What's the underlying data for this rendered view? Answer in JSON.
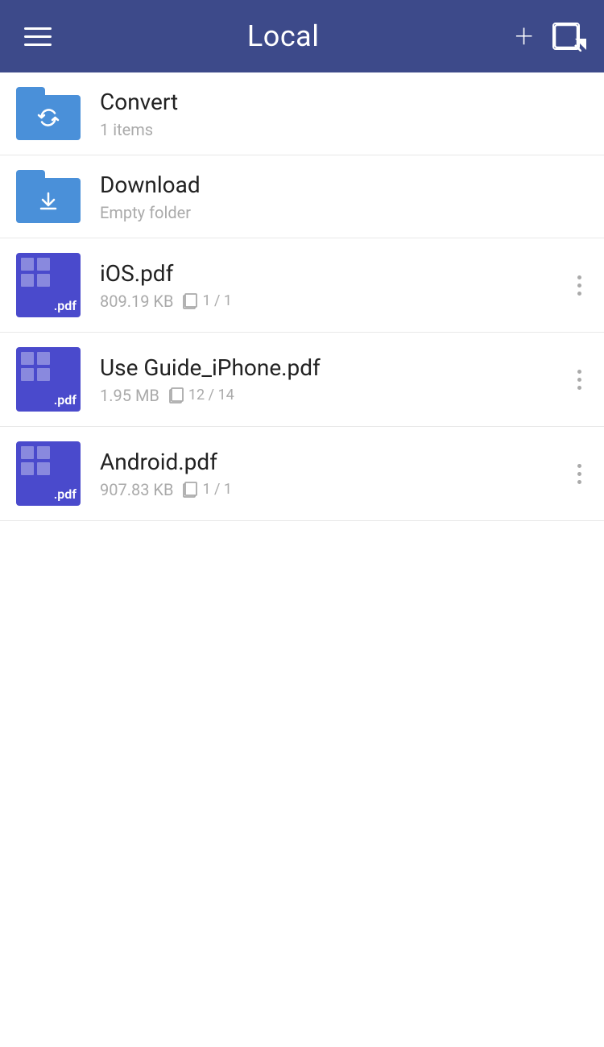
{
  "header": {
    "title": "Local",
    "menu_label": "menu",
    "add_label": "add",
    "select_label": "select"
  },
  "items": [
    {
      "type": "folder",
      "icon_variant": "convert",
      "name": "Convert",
      "meta": "1 items",
      "has_more": false
    },
    {
      "type": "folder",
      "icon_variant": "download",
      "name": "Download",
      "meta": "Empty folder",
      "has_more": false
    },
    {
      "type": "pdf",
      "name": "iOS.pdf",
      "size": "809.19 KB",
      "pages": "1 / 1",
      "has_more": true
    },
    {
      "type": "pdf",
      "name": "Use Guide_iPhone.pdf",
      "size": "1.95 MB",
      "pages": "12 / 14",
      "has_more": true
    },
    {
      "type": "pdf",
      "name": "Android.pdf",
      "size": "907.83 KB",
      "pages": "1 / 1",
      "has_more": true
    }
  ]
}
